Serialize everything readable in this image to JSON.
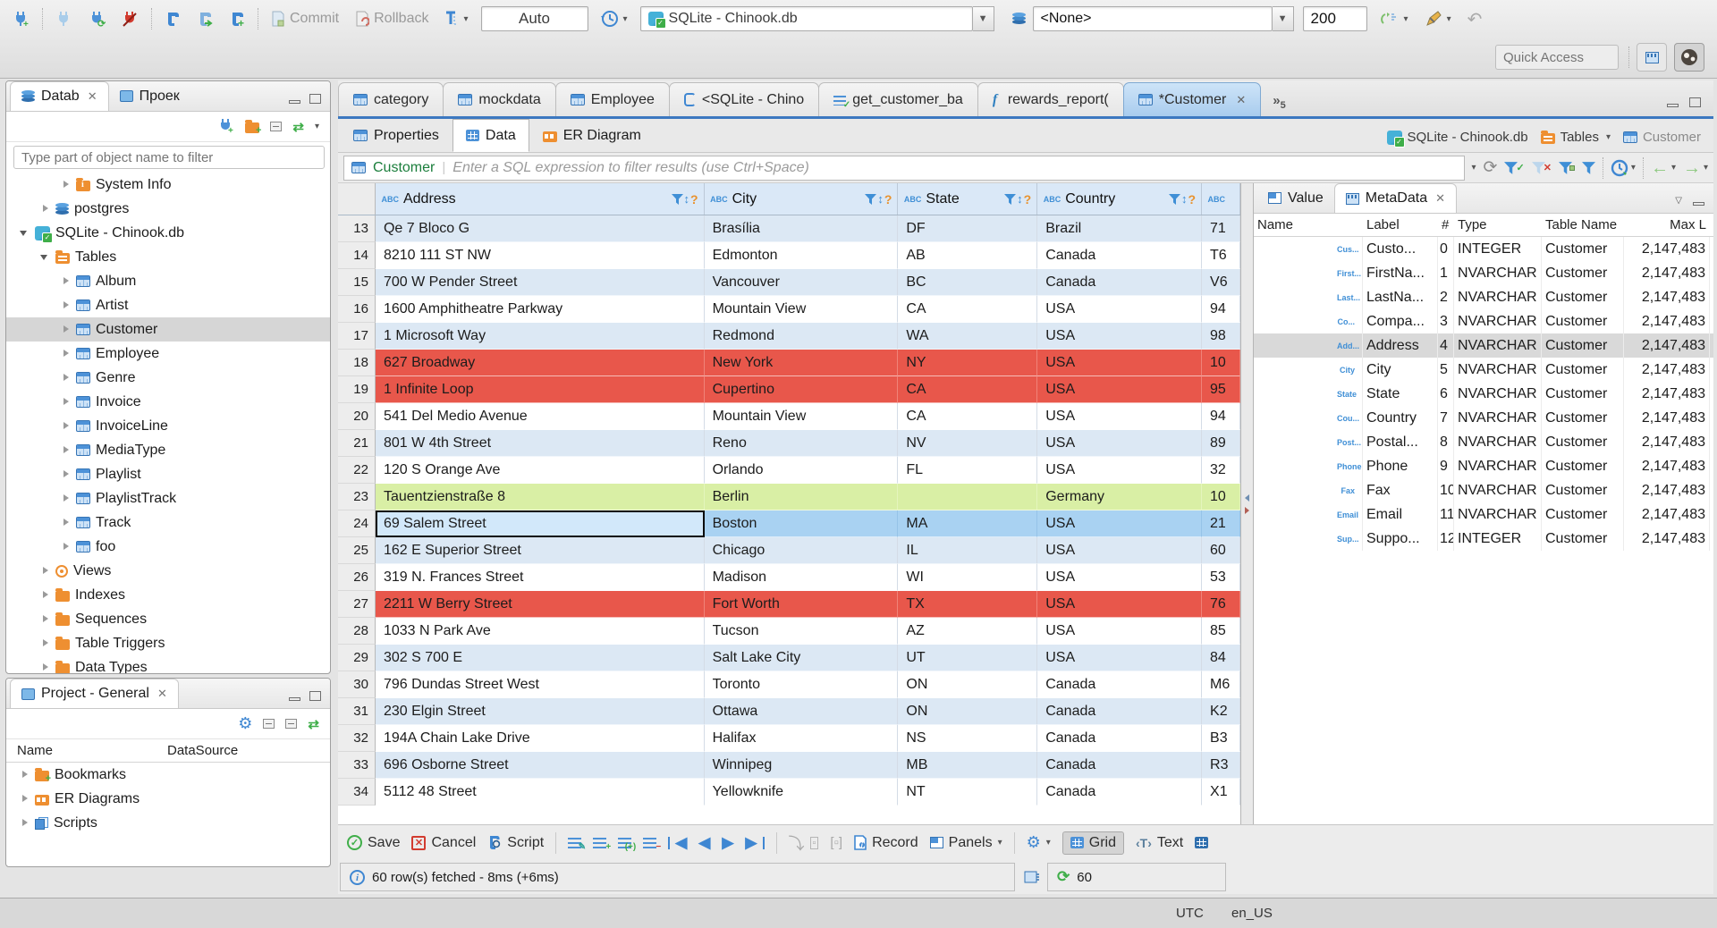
{
  "topbar": {
    "commit": "Commit",
    "rollback": "Rollback",
    "txn_mode": "Auto",
    "connection": "SQLite - Chinook.db",
    "schema": "<None>",
    "fetch_size": "200",
    "quick_access_placeholder": "Quick Access"
  },
  "navigator": {
    "tab_database": "Datab",
    "tab_projects": "Проек",
    "filter_placeholder": "Type part of object name to filter",
    "tree": [
      {
        "label": "System Info",
        "icon": "folder-info",
        "indent": 2,
        "arrow": "right"
      },
      {
        "label": "postgres",
        "icon": "db",
        "indent": 1,
        "arrow": "right"
      },
      {
        "label": "SQLite - Chinook.db",
        "icon": "sqlite",
        "indent": 0,
        "arrow": "down"
      },
      {
        "label": "Tables",
        "icon": "folder-table",
        "indent": 1,
        "arrow": "down"
      },
      {
        "label": "Album",
        "icon": "table",
        "indent": 2,
        "arrow": "right"
      },
      {
        "label": "Artist",
        "icon": "table",
        "indent": 2,
        "arrow": "right"
      },
      {
        "label": "Customer",
        "icon": "table",
        "indent": 2,
        "arrow": "right",
        "selected": true
      },
      {
        "label": "Employee",
        "icon": "table",
        "indent": 2,
        "arrow": "right"
      },
      {
        "label": "Genre",
        "icon": "table",
        "indent": 2,
        "arrow": "right"
      },
      {
        "label": "Invoice",
        "icon": "table",
        "indent": 2,
        "arrow": "right"
      },
      {
        "label": "InvoiceLine",
        "icon": "table",
        "indent": 2,
        "arrow": "right"
      },
      {
        "label": "MediaType",
        "icon": "table",
        "indent": 2,
        "arrow": "right"
      },
      {
        "label": "Playlist",
        "icon": "table",
        "indent": 2,
        "arrow": "right"
      },
      {
        "label": "PlaylistTrack",
        "icon": "table",
        "indent": 2,
        "arrow": "right"
      },
      {
        "label": "Track",
        "icon": "table",
        "indent": 2,
        "arrow": "right"
      },
      {
        "label": "foo",
        "icon": "table",
        "indent": 2,
        "arrow": "right"
      },
      {
        "label": "Views",
        "icon": "view",
        "indent": 1,
        "arrow": "right"
      },
      {
        "label": "Indexes",
        "icon": "folder",
        "indent": 1,
        "arrow": "right"
      },
      {
        "label": "Sequences",
        "icon": "folder",
        "indent": 1,
        "arrow": "right"
      },
      {
        "label": "Table Triggers",
        "icon": "folder",
        "indent": 1,
        "arrow": "right"
      },
      {
        "label": "Data Types",
        "icon": "folder",
        "indent": 1,
        "arrow": "right"
      }
    ]
  },
  "project_panel": {
    "title": "Project - General",
    "col_name": "Name",
    "col_datasource": "DataSource",
    "items": [
      {
        "label": "Bookmarks",
        "icon": "folder-star"
      },
      {
        "label": "ER Diagrams",
        "icon": "erd"
      },
      {
        "label": "Scripts",
        "icon": "scripts"
      }
    ]
  },
  "editor": {
    "tabs": [
      {
        "label": "category",
        "icon": "table"
      },
      {
        "label": "mockdata",
        "icon": "table"
      },
      {
        "label": "Employee",
        "icon": "table"
      },
      {
        "label": "<SQLite - Chino",
        "icon": "sql"
      },
      {
        "label": "get_customer_ba",
        "icon": "script"
      },
      {
        "label": "rewards_report(",
        "icon": "func"
      },
      {
        "label": "*Customer",
        "icon": "table",
        "active": true,
        "closable": true
      }
    ],
    "more_count": "5",
    "subtabs": [
      {
        "label": "Properties",
        "icon": "table"
      },
      {
        "label": "Data",
        "icon": "grid",
        "active": true
      },
      {
        "label": "ER Diagram",
        "icon": "erd-chart"
      }
    ],
    "breadcrumb": [
      {
        "label": "SQLite - Chinook.db",
        "icon": "sqlite"
      },
      {
        "label": "Tables",
        "icon": "folder-table",
        "dropdown": true
      },
      {
        "label": "Customer",
        "icon": "table",
        "dim": true
      }
    ]
  },
  "filter": {
    "table": "Customer",
    "placeholder": "Enter a SQL expression to filter results (use Ctrl+Space)"
  },
  "grid": {
    "columns": [
      {
        "label": "Address"
      },
      {
        "label": "City"
      },
      {
        "label": "State"
      },
      {
        "label": "Country"
      },
      {
        "label": ""
      }
    ],
    "rows": [
      {
        "num": "13",
        "cells": [
          "Qe 7 Bloco G",
          "Brasília",
          "DF",
          "Brazil",
          "71"
        ],
        "style": "stripe"
      },
      {
        "num": "14",
        "cells": [
          "8210 111 ST NW",
          "Edmonton",
          "AB",
          "Canada",
          "T6"
        ],
        "style": "plain"
      },
      {
        "num": "15",
        "cells": [
          "700 W Pender Street",
          "Vancouver",
          "BC",
          "Canada",
          "V6"
        ],
        "style": "stripe"
      },
      {
        "num": "16",
        "cells": [
          "1600 Amphitheatre Parkway",
          "Mountain View",
          "CA",
          "USA",
          "94"
        ],
        "style": "plain"
      },
      {
        "num": "17",
        "cells": [
          "1 Microsoft Way",
          "Redmond",
          "WA",
          "USA",
          "98"
        ],
        "style": "stripe"
      },
      {
        "num": "18",
        "cells": [
          "627 Broadway",
          "New York",
          "NY",
          "USA",
          "10"
        ],
        "style": "red"
      },
      {
        "num": "19",
        "cells": [
          "1 Infinite Loop",
          "Cupertino",
          "CA",
          "USA",
          "95"
        ],
        "style": "red"
      },
      {
        "num": "20",
        "cells": [
          "541 Del Medio Avenue",
          "Mountain View",
          "CA",
          "USA",
          "94"
        ],
        "style": "plain"
      },
      {
        "num": "21",
        "cells": [
          "801 W 4th Street",
          "Reno",
          "NV",
          "USA",
          "89"
        ],
        "style": "stripe"
      },
      {
        "num": "22",
        "cells": [
          "120 S Orange Ave",
          "Orlando",
          "FL",
          "USA",
          "32"
        ],
        "style": "plain"
      },
      {
        "num": "23",
        "cells": [
          "Tauentzienstraße 8",
          "Berlin",
          "",
          "Germany",
          "10"
        ],
        "style": "green"
      },
      {
        "num": "24",
        "cells": [
          "69 Salem Street",
          "Boston",
          "MA",
          "USA",
          "21"
        ],
        "style": "sel"
      },
      {
        "num": "25",
        "cells": [
          "162 E Superior Street",
          "Chicago",
          "IL",
          "USA",
          "60"
        ],
        "style": "stripe"
      },
      {
        "num": "26",
        "cells": [
          "319 N. Frances Street",
          "Madison",
          "WI",
          "USA",
          "53"
        ],
        "style": "plain"
      },
      {
        "num": "27",
        "cells": [
          "2211 W Berry Street",
          "Fort Worth",
          "TX",
          "USA",
          "76"
        ],
        "style": "red"
      },
      {
        "num": "28",
        "cells": [
          "1033 N Park Ave",
          "Tucson",
          "AZ",
          "USA",
          "85"
        ],
        "style": "plain"
      },
      {
        "num": "29",
        "cells": [
          "302 S 700 E",
          "Salt Lake City",
          "UT",
          "USA",
          "84"
        ],
        "style": "stripe"
      },
      {
        "num": "30",
        "cells": [
          "796 Dundas Street West",
          "Toronto",
          "ON",
          "Canada",
          "M6"
        ],
        "style": "plain"
      },
      {
        "num": "31",
        "cells": [
          "230 Elgin Street",
          "Ottawa",
          "ON",
          "Canada",
          "K2"
        ],
        "style": "stripe"
      },
      {
        "num": "32",
        "cells": [
          "194A Chain Lake Drive",
          "Halifax",
          "NS",
          "Canada",
          "B3"
        ],
        "style": "plain"
      },
      {
        "num": "33",
        "cells": [
          "696 Osborne Street",
          "Winnipeg",
          "MB",
          "Canada",
          "R3"
        ],
        "style": "stripe"
      },
      {
        "num": "34",
        "cells": [
          "5112 48 Street",
          "Yellowknife",
          "NT",
          "Canada",
          "X1"
        ],
        "style": "plain"
      }
    ]
  },
  "side_panel": {
    "tab_value": "Value",
    "tab_metadata": "MetaData",
    "columns": [
      "Name",
      "Label",
      "#",
      "Type",
      "Table Name",
      "Max L"
    ],
    "rows": [
      {
        "icon": "123",
        "name": "Cus...",
        "label": "Custo...",
        "num": "0",
        "type": "INTEGER",
        "table": "Customer",
        "max": "2,147,483"
      },
      {
        "icon": "ABC",
        "name": "First...",
        "label": "FirstNa...",
        "num": "1",
        "type": "NVARCHAR",
        "table": "Customer",
        "max": "2,147,483"
      },
      {
        "icon": "ABC",
        "name": "Last...",
        "label": "LastNa...",
        "num": "2",
        "type": "NVARCHAR",
        "table": "Customer",
        "max": "2,147,483"
      },
      {
        "icon": "ABC",
        "name": "Co...",
        "label": "Compa...",
        "num": "3",
        "type": "NVARCHAR",
        "table": "Customer",
        "max": "2,147,483"
      },
      {
        "icon": "ABC",
        "name": "Add...",
        "label": "Address",
        "num": "4",
        "type": "NVARCHAR",
        "table": "Customer",
        "max": "2,147,483",
        "selected": true
      },
      {
        "icon": "ABC",
        "name": "City",
        "label": "City",
        "num": "5",
        "type": "NVARCHAR",
        "table": "Customer",
        "max": "2,147,483"
      },
      {
        "icon": "ABC",
        "name": "State",
        "label": "State",
        "num": "6",
        "type": "NVARCHAR",
        "table": "Customer",
        "max": "2,147,483"
      },
      {
        "icon": "ABC",
        "name": "Cou...",
        "label": "Country",
        "num": "7",
        "type": "NVARCHAR",
        "table": "Customer",
        "max": "2,147,483"
      },
      {
        "icon": "ABC",
        "name": "Post...",
        "label": "Postal...",
        "num": "8",
        "type": "NVARCHAR",
        "table": "Customer",
        "max": "2,147,483"
      },
      {
        "icon": "ABC",
        "name": "Phone",
        "label": "Phone",
        "num": "9",
        "type": "NVARCHAR",
        "table": "Customer",
        "max": "2,147,483"
      },
      {
        "icon": "ABC",
        "name": "Fax",
        "label": "Fax",
        "num": "10",
        "type": "NVARCHAR",
        "table": "Customer",
        "max": "2,147,483"
      },
      {
        "icon": "ABC",
        "name": "Email",
        "label": "Email",
        "num": "11",
        "type": "NVARCHAR",
        "table": "Customer",
        "max": "2,147,483"
      },
      {
        "icon": "123",
        "name": "Sup...",
        "label": "Suppo...",
        "num": "12",
        "type": "INTEGER",
        "table": "Customer",
        "max": "2,147,483"
      }
    ]
  },
  "bottom_toolbar": {
    "save": "Save",
    "cancel": "Cancel",
    "script": "Script",
    "record": "Record",
    "panels": "Panels",
    "grid": "Grid",
    "text": "Text"
  },
  "status": {
    "info": "60 row(s) fetched - 8ms (+6ms)",
    "auto_refresh": "60"
  },
  "window_status": {
    "timezone": "UTC",
    "locale": "en_US"
  },
  "colors": {
    "accent_blue": "#3f8fd6",
    "stripe_row": "#dce8f4",
    "red_row": "#e8574b",
    "green_row": "#d9efa5",
    "selected_row": "#a9d2f2",
    "table_name_green": "#1b7e3c"
  }
}
